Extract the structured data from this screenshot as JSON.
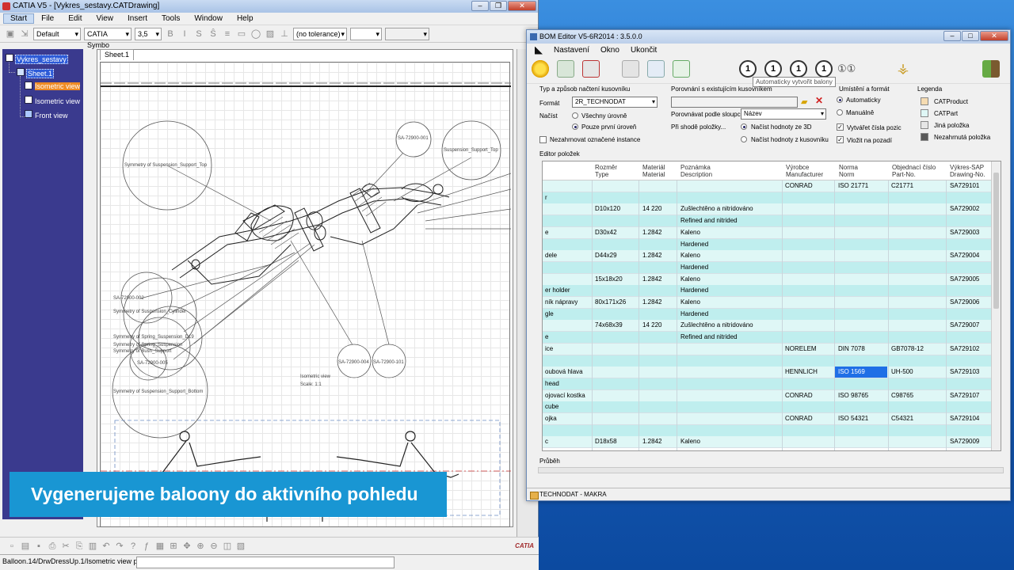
{
  "catia": {
    "title": "CATIA V5 - [Vykres_sestavy.CATDrawing]",
    "menu": [
      "Start",
      "File",
      "Edit",
      "View",
      "Insert",
      "Tools",
      "Window",
      "Help"
    ],
    "font_style": "Default",
    "font_name": "CATIA Symbo",
    "font_size": "3,5",
    "tolerance": "(no tolerance)",
    "tree": {
      "root": "Vykres_sestavy",
      "sheet": "Sheet.1",
      "views": [
        "Isometric view",
        "Isometric view",
        "Front view"
      ]
    },
    "sheet_tab": "Sheet.1",
    "balloons": [
      "Symmetry of Suspension_Support_Top",
      "SA-72900-001",
      "Suspension_Support_Top",
      "SA-72900-002",
      "Symmetry of Suspension_Cylinder",
      "Symmetry of Spring_Suspension_D19",
      "Symmetry of Spring_Suspension",
      "Symmetry of Bush_Support",
      "SA-72900-005",
      "Symmetry of Suspension_Support_Bottom",
      "SA-72900-004",
      "SA-72900-101"
    ],
    "view_label": "Isometric view",
    "view_scale": "Scale:  1:1",
    "status": "Balloon.14/DrwDressUp.1/Isometric view preselected",
    "logo_text": "CATIA"
  },
  "banner": "Vygenerujeme baloony do aktivního pohledu",
  "bom": {
    "title": "BOM Editor V5-6R2014 : 3.5.0.0",
    "menu": [
      "Nastavení",
      "Okno",
      "Ukončit"
    ],
    "tooltip": "Automaticky vytvořit balony",
    "load_group": {
      "title": "Typ a způsob načtení kusovníku",
      "format_label": "Formát",
      "format_value": "2R_TECHNODAT",
      "load_label": "Načíst",
      "opt_all": "Všechny úrovně",
      "opt_first": "Pouze první úroveň",
      "ignore_marked": "Nezahrnovat označené instance"
    },
    "compare_group": {
      "title": "Porovnání s existujícím kusovníkem",
      "compare_by_label": "Porovnávat podle sloupce",
      "compare_by_value": "Název",
      "on_match_label": "Při shodě položky...",
      "opt_3d": "Načíst hodnoty ze 3D",
      "opt_bom": "Načíst hodnoty z kusovníku"
    },
    "place_group": {
      "title": "Umístění a formát",
      "opt_auto": "Automaticky",
      "opt_manual": "Manuálně",
      "chk_numbers": "Vytvářet čísla pozic",
      "chk_background": "Vložit na pozadí"
    },
    "legend": {
      "title": "Legenda",
      "items": [
        {
          "label": "CATProduct",
          "color": "#f6dcb2"
        },
        {
          "label": "CATPart",
          "color": "#dff7f6"
        },
        {
          "label": "Jiná položka",
          "color": "#e6e6e6"
        },
        {
          "label": "Nezahrnutá položka",
          "color": "#5a5a5a"
        }
      ]
    },
    "editor_label": "Editor položek",
    "columns": [
      "Rozměr\nType",
      "Materiál\nMaterial",
      "Poznámka\nDescription",
      "Výrobce\nManufacturer",
      "Norma\nNorm",
      "Objednací číslo\nPart-No.",
      "Výkres-SAP\nDrawing-No."
    ],
    "rows": [
      {
        "name": "",
        "dim": "",
        "mat": "",
        "note": "",
        "manuf": "CONRAD",
        "norm": "ISO 21771",
        "part": "C21771",
        "drw": "SA729101"
      },
      {
        "name": "r",
        "dim": "",
        "mat": "",
        "note": "",
        "manuf": "",
        "norm": "",
        "part": "",
        "drw": ""
      },
      {
        "name": "",
        "dim": "D10x120",
        "mat": "14 220",
        "note": "Zušlechtěno a nitridováno",
        "manuf": "",
        "norm": "",
        "part": "",
        "drw": "SA729002"
      },
      {
        "name": "",
        "dim": "",
        "mat": "",
        "note": "Refined and nitrided",
        "manuf": "",
        "norm": "",
        "part": "",
        "drw": ""
      },
      {
        "name": "e",
        "dim": "D30x42",
        "mat": "1.2842",
        "note": "Kaleno",
        "manuf": "",
        "norm": "",
        "part": "",
        "drw": "SA729003"
      },
      {
        "name": "",
        "dim": "",
        "mat": "",
        "note": "Hardened",
        "manuf": "",
        "norm": "",
        "part": "",
        "drw": ""
      },
      {
        "name": "dele",
        "dim": "D44x29",
        "mat": "1.2842",
        "note": "Kaleno",
        "manuf": "",
        "norm": "",
        "part": "",
        "drw": "SA729004"
      },
      {
        "name": "",
        "dim": "",
        "mat": "",
        "note": "Hardened",
        "manuf": "",
        "norm": "",
        "part": "",
        "drw": ""
      },
      {
        "name": "",
        "dim": "15x18x20",
        "mat": "1.2842",
        "note": "Kaleno",
        "manuf": "",
        "norm": "",
        "part": "",
        "drw": "SA729005"
      },
      {
        "name": "er holder",
        "dim": "",
        "mat": "",
        "note": "Hardened",
        "manuf": "",
        "norm": "",
        "part": "",
        "drw": ""
      },
      {
        "name": "ník nápravy",
        "dim": "80x171x26",
        "mat": "1.2842",
        "note": "Kaleno",
        "manuf": "",
        "norm": "",
        "part": "",
        "drw": "SA729006"
      },
      {
        "name": "gle",
        "dim": "",
        "mat": "",
        "note": "Hardened",
        "manuf": "",
        "norm": "",
        "part": "",
        "drw": ""
      },
      {
        "name": "",
        "dim": "74x68x39",
        "mat": "14 220",
        "note": "Zušlechtěno a nitridováno",
        "manuf": "",
        "norm": "",
        "part": "",
        "drw": "SA729007"
      },
      {
        "name": "e",
        "dim": "",
        "mat": "",
        "note": "Refined and nitrided",
        "manuf": "",
        "norm": "",
        "part": "",
        "drw": ""
      },
      {
        "name": "ice",
        "dim": "",
        "mat": "",
        "note": "",
        "manuf": "NORELEM",
        "norm": "DIN 7078",
        "part": "GB7078-12",
        "drw": "SA729102"
      },
      {
        "name": "",
        "dim": "",
        "mat": "",
        "note": "",
        "manuf": "",
        "norm": "",
        "part": "",
        "drw": ""
      },
      {
        "name": "oubová hlava",
        "dim": "",
        "mat": "",
        "note": "",
        "manuf": "HENNLICH",
        "norm": "ISO 1569",
        "part": "UH-500",
        "drw": "SA729103"
      },
      {
        "name": "head",
        "dim": "",
        "mat": "",
        "note": "",
        "manuf": "",
        "norm": "",
        "part": "",
        "drw": ""
      },
      {
        "name": "ojovací kostka",
        "dim": "",
        "mat": "",
        "note": "",
        "manuf": "CONRAD",
        "norm": "ISO 98765",
        "part": "C98765",
        "drw": "SA729107"
      },
      {
        "name": "cube",
        "dim": "",
        "mat": "",
        "note": "",
        "manuf": "",
        "norm": "",
        "part": "",
        "drw": ""
      },
      {
        "name": "ojka",
        "dim": "",
        "mat": "",
        "note": "",
        "manuf": "CONRAD",
        "norm": "ISO 54321",
        "part": "C54321",
        "drw": "SA729104"
      },
      {
        "name": "",
        "dim": "",
        "mat": "",
        "note": "",
        "manuf": "",
        "norm": "",
        "part": "",
        "drw": ""
      },
      {
        "name": "c",
        "dim": "D18x58",
        "mat": "1.2842",
        "note": "Kaleno",
        "manuf": "",
        "norm": "",
        "part": "",
        "drw": "SA729009"
      }
    ],
    "progress_label": "Průběh",
    "status": "TECHNODAT - MAKRA"
  }
}
